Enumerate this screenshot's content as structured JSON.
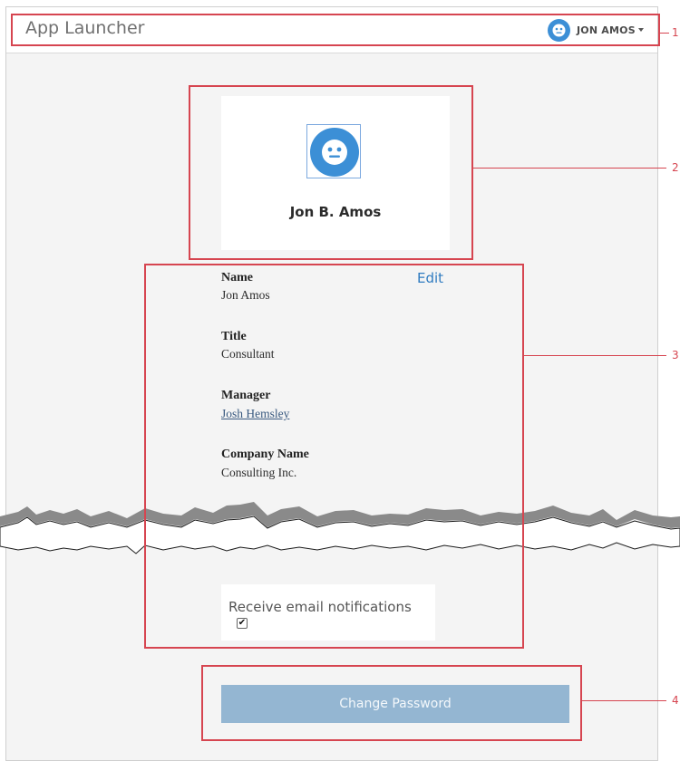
{
  "header": {
    "app_title": "App Launcher",
    "user_name": "JON AMOS"
  },
  "profile": {
    "name": "Jon B. Amos"
  },
  "details": {
    "edit_label": "Edit",
    "fields": [
      {
        "label": "Name",
        "value": "Jon Amos"
      },
      {
        "label": "Title",
        "value": "Consultant"
      },
      {
        "label": "Manager",
        "value": "Josh Hemsley"
      },
      {
        "label": "Company Name",
        "value": "Consulting Inc."
      }
    ]
  },
  "notifications": {
    "label": "Receive email notifications",
    "checked": true
  },
  "actions": {
    "change_password": "Change Password"
  },
  "callouts": [
    "1",
    "2",
    "3",
    "4"
  ],
  "icons": {
    "avatar": "smiley-face-icon",
    "menu": "caret-down-icon",
    "checkbox": "checkmark-icon"
  },
  "colors": {
    "accent": "#3c8fd6",
    "callout": "#d64550",
    "button": "#94b6d2",
    "link": "#2f7bc0"
  }
}
